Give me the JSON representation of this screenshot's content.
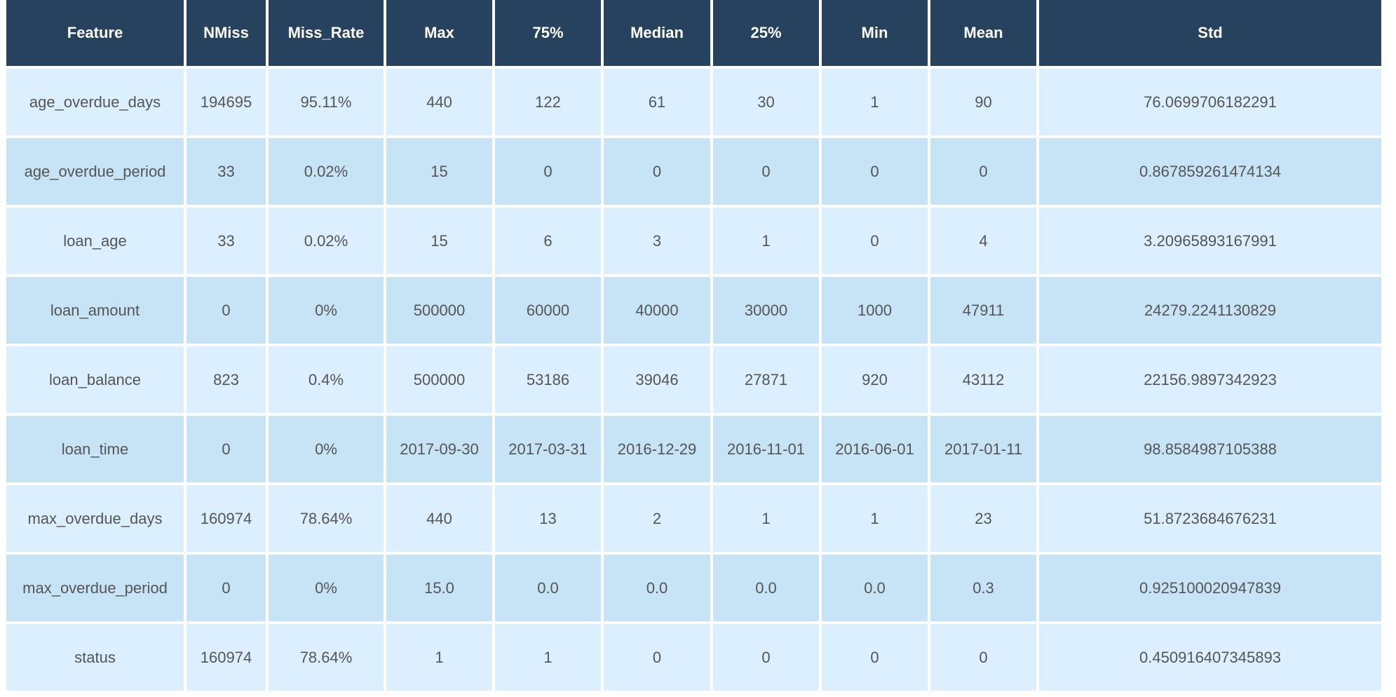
{
  "table": {
    "columns": [
      "Feature",
      "NMiss",
      "Miss_Rate",
      "Max",
      "75%",
      "Median",
      "25%",
      "Min",
      "Mean",
      "Std"
    ],
    "rows": [
      [
        "age_overdue_days",
        "194695",
        "95.11%",
        "440",
        "122",
        "61",
        "30",
        "1",
        "90",
        "76.0699706182291"
      ],
      [
        "age_overdue_period",
        "33",
        "0.02%",
        "15",
        "0",
        "0",
        "0",
        "0",
        "0",
        "0.867859261474134"
      ],
      [
        "loan_age",
        "33",
        "0.02%",
        "15",
        "6",
        "3",
        "1",
        "0",
        "4",
        "3.20965893167991"
      ],
      [
        "loan_amount",
        "0",
        "0%",
        "500000",
        "60000",
        "40000",
        "30000",
        "1000",
        "47911",
        "24279.2241130829"
      ],
      [
        "loan_balance",
        "823",
        "0.4%",
        "500000",
        "53186",
        "39046",
        "27871",
        "920",
        "43112",
        "22156.9897342923"
      ],
      [
        "loan_time",
        "0",
        "0%",
        "2017-09-30",
        "2017-03-31",
        "2016-12-29",
        "2016-11-01",
        "2016-06-01",
        "2017-01-11",
        "98.8584987105388"
      ],
      [
        "max_overdue_days",
        "160974",
        "78.64%",
        "440",
        "13",
        "2",
        "1",
        "1",
        "23",
        "51.8723684676231"
      ],
      [
        "max_overdue_period",
        "0",
        "0%",
        "15.0",
        "0.0",
        "0.0",
        "0.0",
        "0.0",
        "0.3",
        "0.925100020947839"
      ],
      [
        "status",
        "160974",
        "78.64%",
        "1",
        "1",
        "0",
        "0",
        "0",
        "0",
        "0.450916407345893"
      ]
    ]
  },
  "colors": {
    "header_bg": "#27425f",
    "header_text": "#ffffff",
    "row_light": "#dcefff",
    "row_dark": "#c6e4f6",
    "cell_text": "#555555"
  }
}
